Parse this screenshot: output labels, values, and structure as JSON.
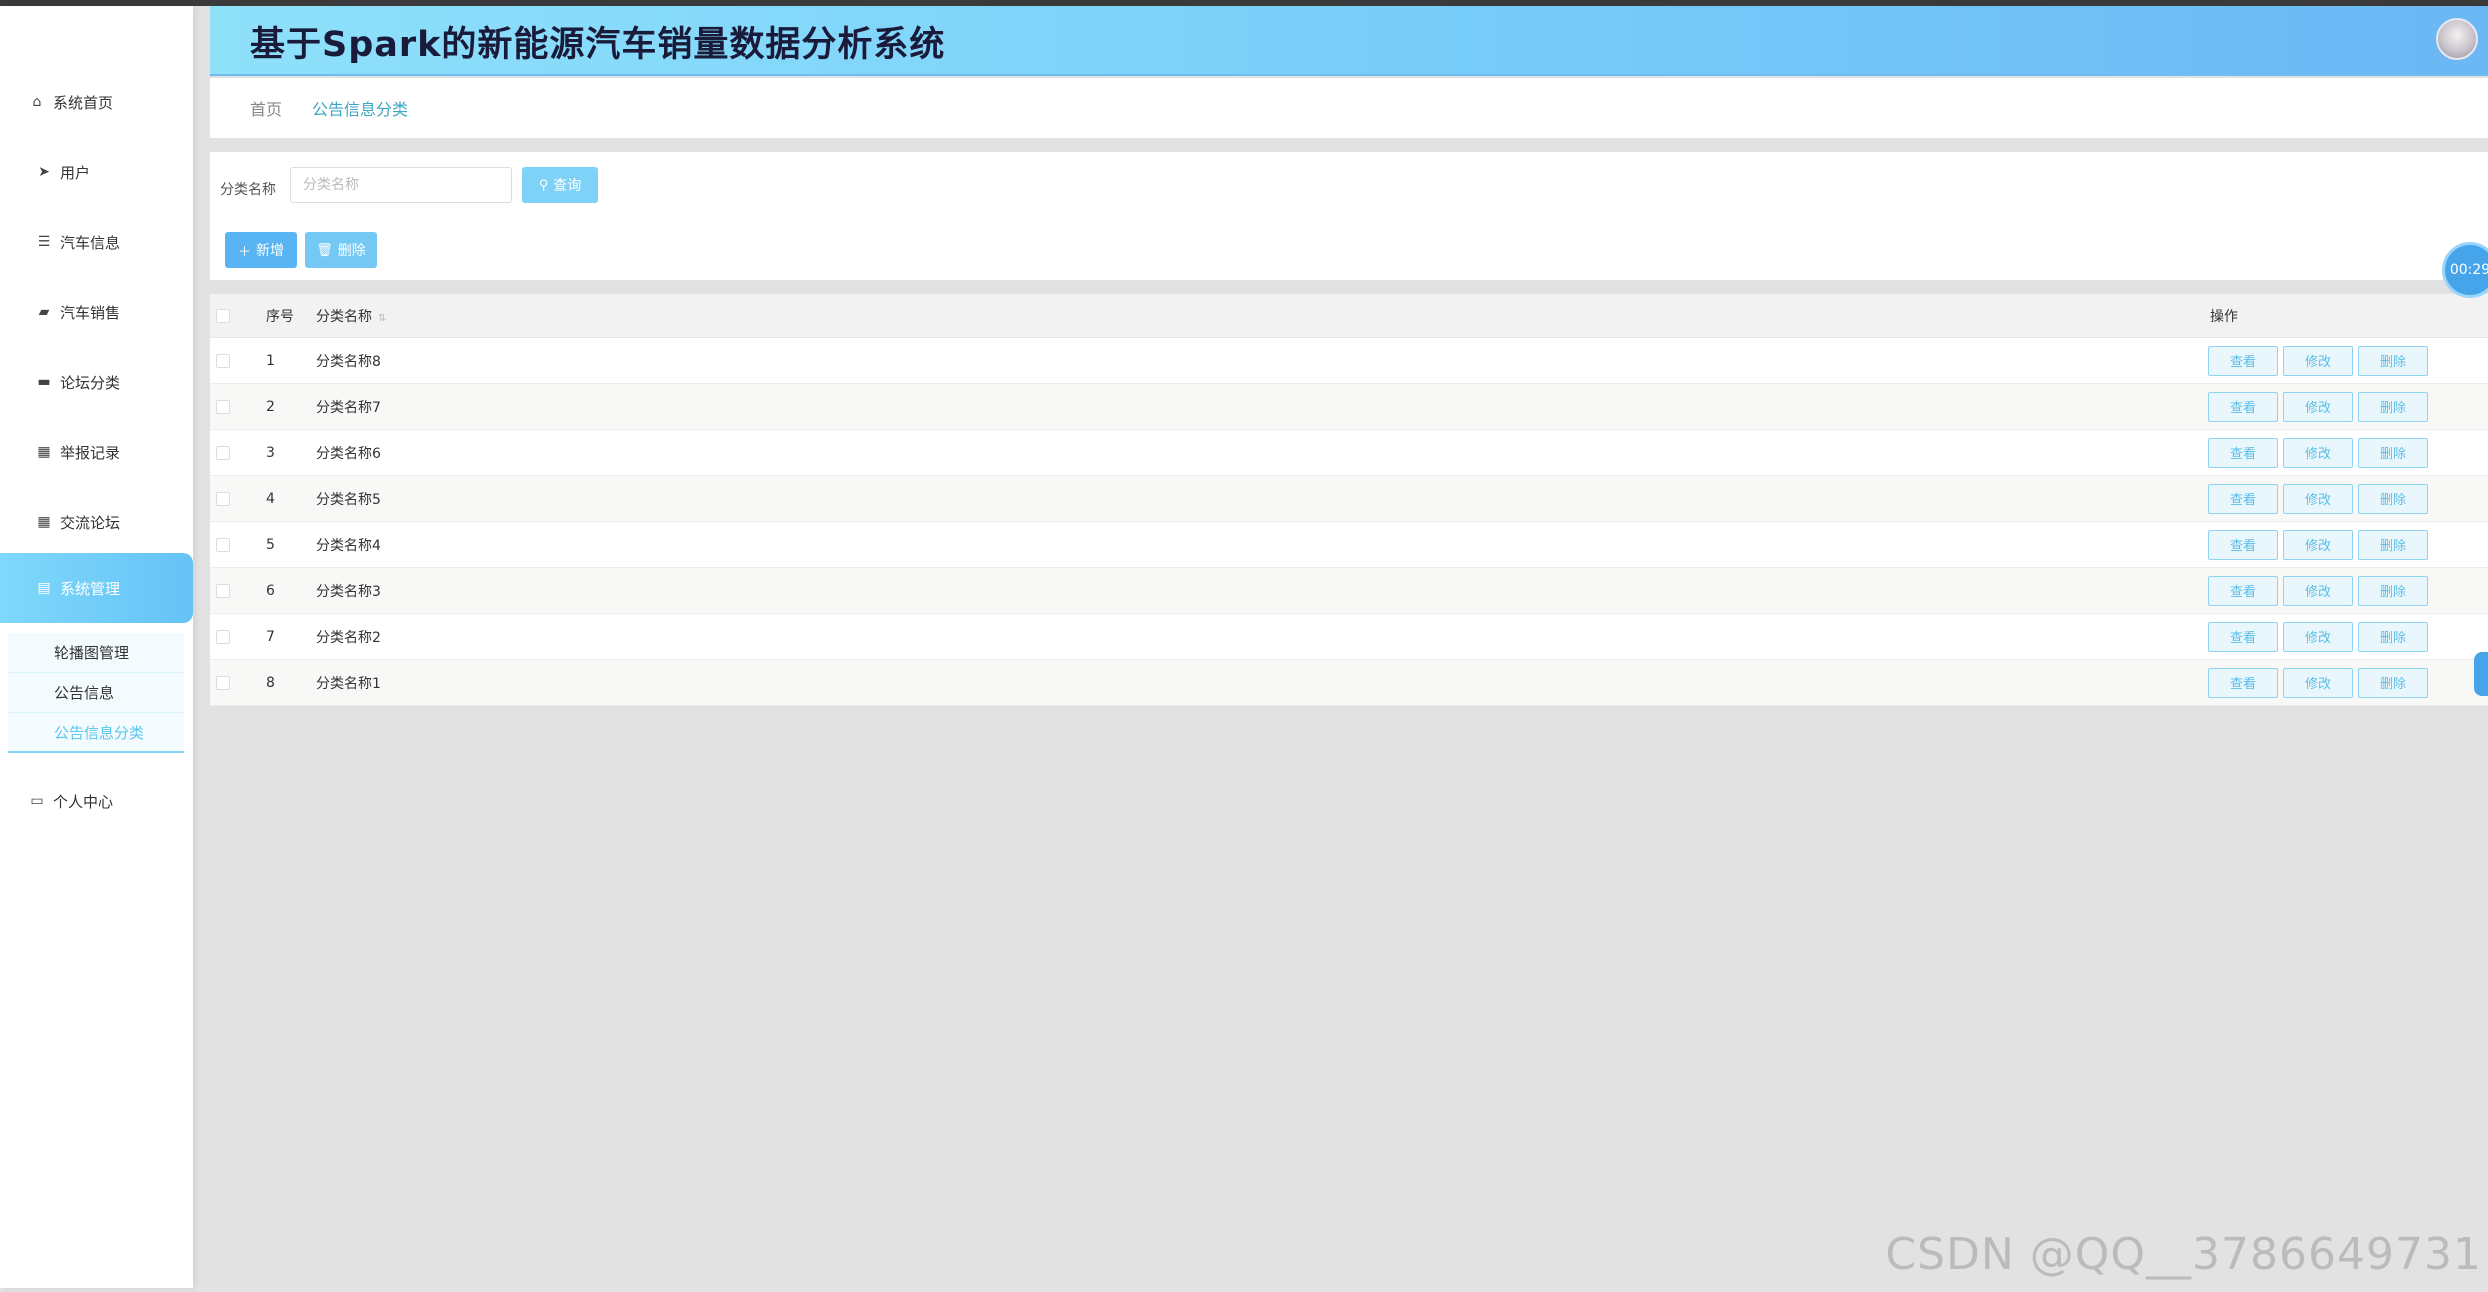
{
  "header": {
    "title": "基于Spark的新能源汽车销量数据分析系统"
  },
  "sidebar": {
    "items": [
      {
        "label": "系统首页",
        "icon": "home-icon"
      },
      {
        "label": "用户",
        "icon": "send-icon"
      },
      {
        "label": "汽车信息",
        "icon": "list-icon"
      },
      {
        "label": "汽车销售",
        "icon": "ticket-icon"
      },
      {
        "label": "论坛分类",
        "icon": "monitor-icon"
      },
      {
        "label": "举报记录",
        "icon": "grid-icon"
      },
      {
        "label": "交流论坛",
        "icon": "grid-icon"
      },
      {
        "label": "系统管理",
        "icon": "clipboard-icon"
      },
      {
        "label": "个人中心",
        "icon": "card-icon"
      }
    ],
    "submenu": [
      {
        "label": "轮播图管理"
      },
      {
        "label": "公告信息"
      },
      {
        "label": "公告信息分类"
      }
    ]
  },
  "breadcrumb": {
    "home": "首页",
    "current": "公告信息分类"
  },
  "search": {
    "label": "分类名称",
    "placeholder": "分类名称",
    "button": "查询"
  },
  "actions": {
    "add": "新增",
    "delete": "删除"
  },
  "timer": "00:29",
  "table": {
    "headers": {
      "index": "序号",
      "name": "分类名称",
      "ops": "操作"
    },
    "rows": [
      {
        "index": "1",
        "name": "分类名称8"
      },
      {
        "index": "2",
        "name": "分类名称7"
      },
      {
        "index": "3",
        "name": "分类名称6"
      },
      {
        "index": "4",
        "name": "分类名称5"
      },
      {
        "index": "5",
        "name": "分类名称4"
      },
      {
        "index": "6",
        "name": "分类名称3"
      },
      {
        "index": "7",
        "name": "分类名称2"
      },
      {
        "index": "8",
        "name": "分类名称1"
      }
    ],
    "op_labels": {
      "view": "查看",
      "edit": "修改",
      "delete": "删除"
    }
  },
  "watermark": "CSDN @QQ__3786649731",
  "colors": {
    "accent": "#66c2f6",
    "header_start": "#8fe1fa",
    "header_end": "#6bb7f5"
  }
}
